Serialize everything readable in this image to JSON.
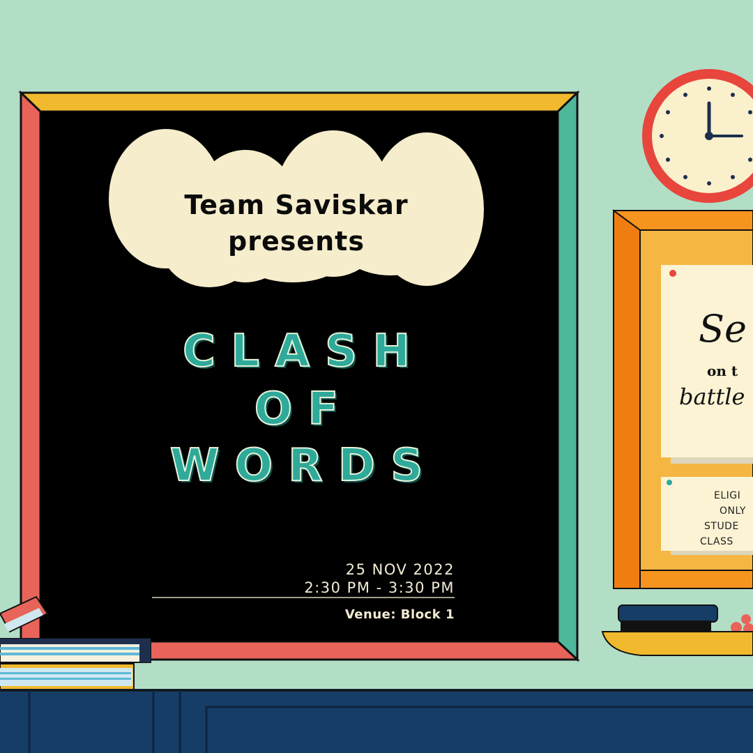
{
  "poster": {
    "presenter_line1": "Team Saviskar",
    "presenter_line2": "presents",
    "title_line1": "C L A S H",
    "title_line2": "O F",
    "title_line3": "W O R D S",
    "date": "25 NOV 2022",
    "time": "2:30 PM - 3:30 PM",
    "venue": "Venue: Block 1"
  },
  "noticeboard": {
    "note1_word1": "Se",
    "note1_word2": "on t",
    "note1_word3": "battle",
    "note2_line1": "ELIGI",
    "note2_line2": "ONLY",
    "note2_line3": "STUDE",
    "note2_line4": "CLASS"
  },
  "colors": {
    "wall": "#b2dec6",
    "board": "#000000",
    "frame_top": "#f0b92e",
    "frame_left": "#e8645a",
    "frame_right": "#4fb89a",
    "title_teal": "#2fa99a",
    "cloud": "#f6edcc",
    "cabinet": "#163d66"
  }
}
